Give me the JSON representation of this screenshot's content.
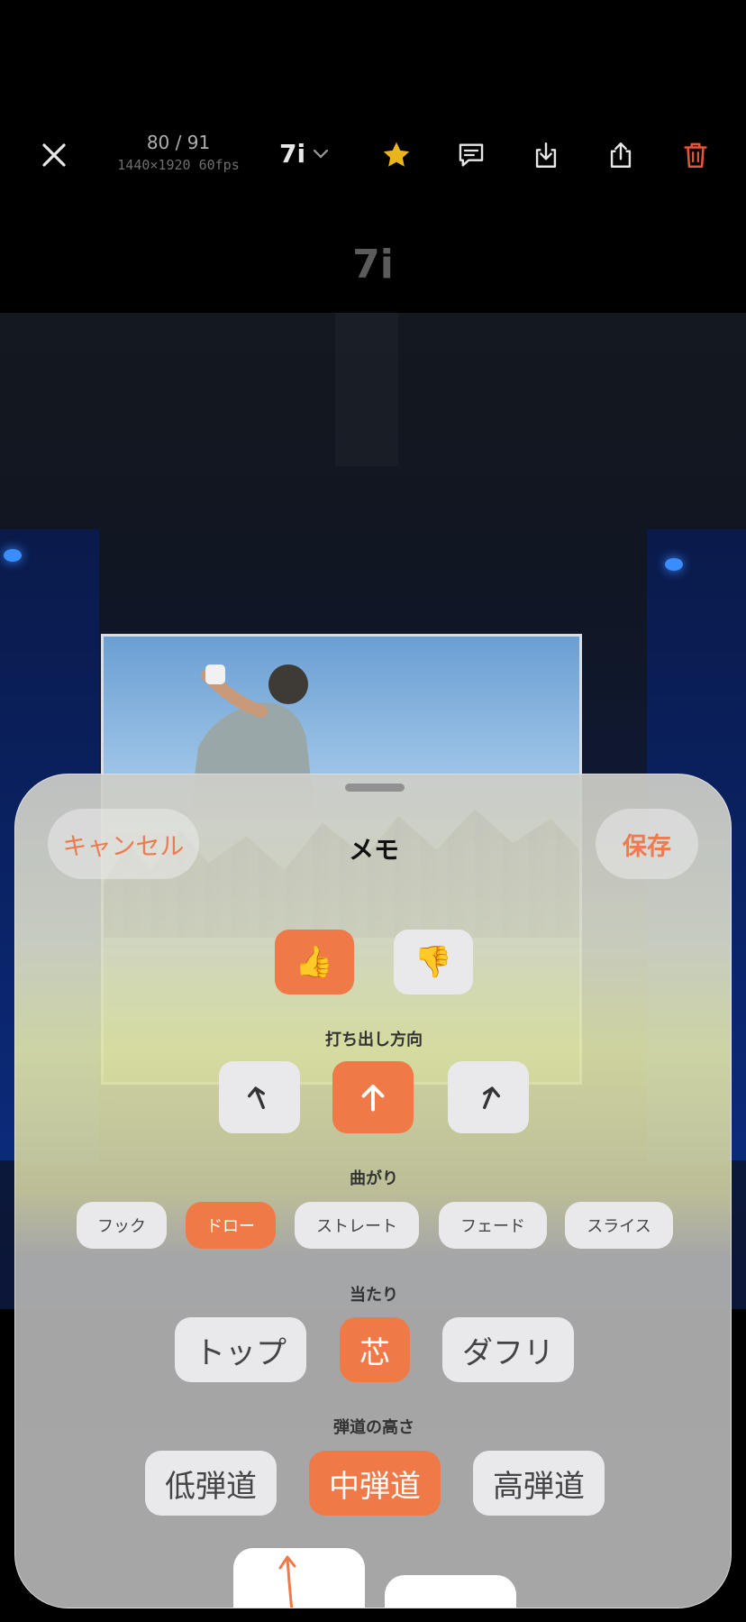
{
  "topbar": {
    "counter": "80 / 91",
    "video_meta": "1440×1920 60fps",
    "club": "7i",
    "icons": [
      "close-icon",
      "chevron-down-icon",
      "star-icon",
      "comment-icon",
      "download-icon",
      "share-icon",
      "trash-icon"
    ]
  },
  "club_title": "7i",
  "sheet": {
    "cancel": "キャンセル",
    "title": "メモ",
    "save": "保存",
    "feedback": {
      "good": "👍",
      "bad": "👎",
      "selected": "good"
    },
    "direction": {
      "label": "打ち出し方向",
      "options": [
        "left-arrow-icon",
        "up-arrow-icon",
        "right-arrow-icon"
      ],
      "selected": 1
    },
    "curve": {
      "label": "曲がり",
      "options": [
        "フック",
        "ドロー",
        "ストレート",
        "フェード",
        "スライス"
      ],
      "selected": 1
    },
    "contact": {
      "label": "当たり",
      "options": [
        "トップ",
        "芯",
        "ダフリ"
      ],
      "selected": 1
    },
    "height": {
      "label": "弾道の高さ",
      "options": [
        "低弾道",
        "中弾道",
        "高弾道"
      ],
      "selected": 1
    }
  },
  "colors": {
    "accent": "#f07a47",
    "star": "#e9b51a",
    "delete": "#e2563a"
  }
}
